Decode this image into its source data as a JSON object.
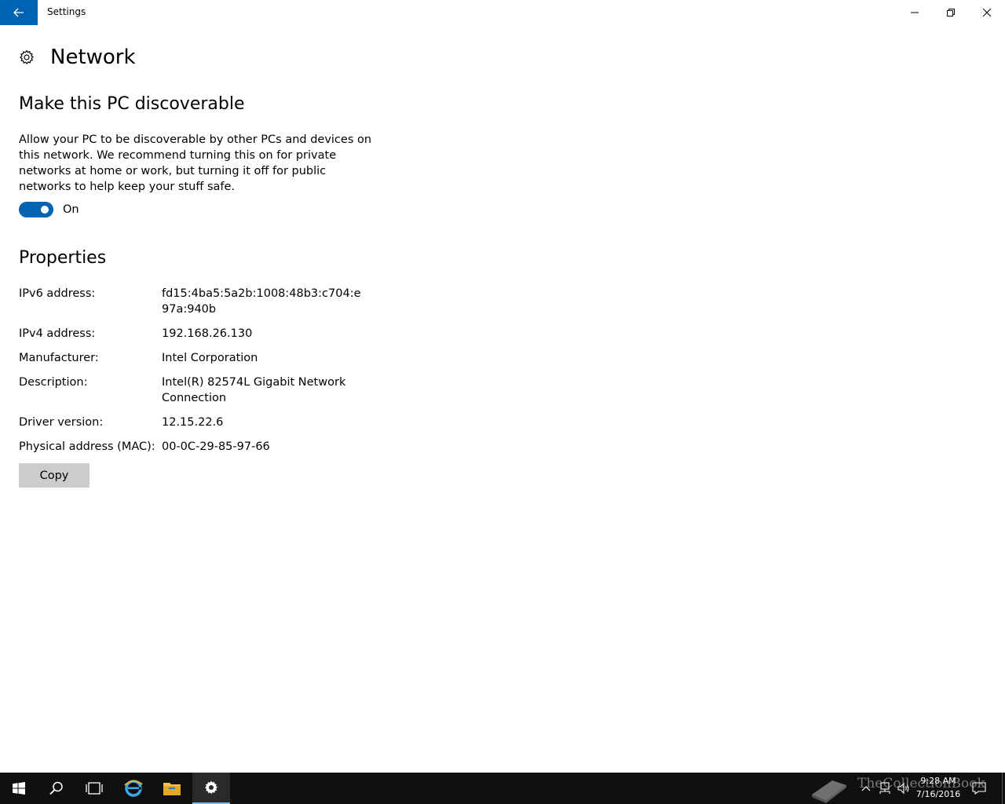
{
  "window": {
    "title": "Settings",
    "accent_color": "#0063b1"
  },
  "page": {
    "title": "Network",
    "icon": "gear-icon"
  },
  "discoverable": {
    "heading": "Make this PC discoverable",
    "description": "Allow your PC to be discoverable by other PCs and devices on this network. We recommend turning this on for private networks at home or work, but turning it off for public networks to help keep your stuff safe.",
    "toggle_state": "On",
    "toggle_on": true
  },
  "properties": {
    "heading": "Properties",
    "rows": [
      {
        "label": "IPv6 address:",
        "value": "fd15:4ba5:5a2b:1008:48b3:c704:e97a:940b"
      },
      {
        "label": "IPv4 address:",
        "value": "192.168.26.130"
      },
      {
        "label": "Manufacturer:",
        "value": "Intel Corporation"
      },
      {
        "label": "Description:",
        "value": "Intel(R) 82574L Gigabit Network Connection"
      },
      {
        "label": "Driver version:",
        "value": "12.15.22.6"
      },
      {
        "label": "Physical address (MAC):",
        "value": "00-0C-29-85-97-66"
      }
    ],
    "copy_label": "Copy"
  },
  "taskbar": {
    "items": [
      "start-icon",
      "search-icon",
      "task-view-icon",
      "edge-browser-icon",
      "file-explorer-icon",
      "settings-icon"
    ],
    "time": "9:28 AM",
    "date": "7/16/2016",
    "watermark": "TheCollectionBook"
  }
}
